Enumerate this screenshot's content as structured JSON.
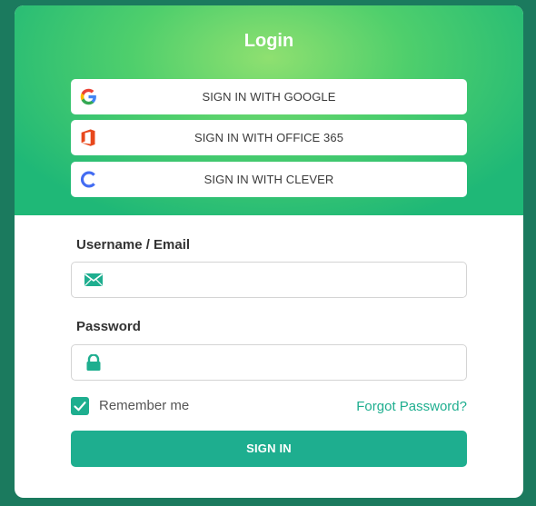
{
  "header": {
    "title": "Login"
  },
  "sso": {
    "google_label": "SIGN IN WITH GOOGLE",
    "office_label": "SIGN IN WITH OFFICE 365",
    "clever_label": "SIGN IN WITH CLEVER",
    "google_icon": "google-logo-icon",
    "office_icon": "office-logo-icon",
    "clever_icon": "clever-logo-icon"
  },
  "form": {
    "username_label": "Username / Email",
    "username_value": "",
    "username_icon": "envelope-icon",
    "password_label": "Password",
    "password_value": "",
    "password_icon": "lock-icon",
    "remember_label": "Remember me",
    "remember_checked": true,
    "forgot_label": "Forgot Password?",
    "submit_label": "SIGN IN"
  },
  "colors": {
    "background": "#1b7a5e",
    "accent": "#1eae8f",
    "header_gradient_center": "#8fe070",
    "header_gradient_edge": "#1fb877"
  }
}
